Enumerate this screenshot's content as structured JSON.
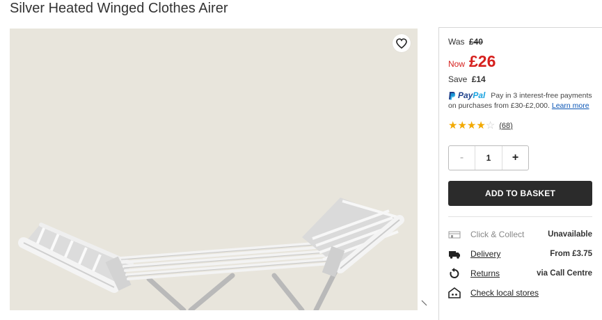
{
  "product": {
    "title": "Silver Heated Winged Clothes Airer"
  },
  "pricing": {
    "was_label": "Was",
    "was_price": "£40",
    "now_label": "Now",
    "now_price": "£26",
    "save_label": "Save",
    "save_amount": "£14"
  },
  "paypal": {
    "brand_pay": "Pay",
    "brand_pal": "Pal",
    "text": "Pay in 3 interest-free payments on purchases from £30-£2,000.",
    "link": "Learn more"
  },
  "rating": {
    "stars": 4,
    "max": 5,
    "count": "(68)"
  },
  "quantity": {
    "minus": "-",
    "value": "1",
    "plus": "+"
  },
  "basket": {
    "add_label": "ADD TO BASKET"
  },
  "fulfilment": [
    {
      "icon": "store-icon",
      "label": "Click & Collect",
      "value": "Unavailable"
    },
    {
      "icon": "truck-icon",
      "label": "Delivery",
      "value": "From £3.75"
    },
    {
      "icon": "returns-icon",
      "label": "Returns",
      "value": "via Call Centre"
    },
    {
      "icon": "shop-icon",
      "label": "Check local stores",
      "value": ""
    }
  ],
  "colors": {
    "price_red": "#d6201d",
    "button_dark": "#2b2b2b",
    "star_gold": "#f2a900",
    "image_bg": "#e8e5dc"
  }
}
